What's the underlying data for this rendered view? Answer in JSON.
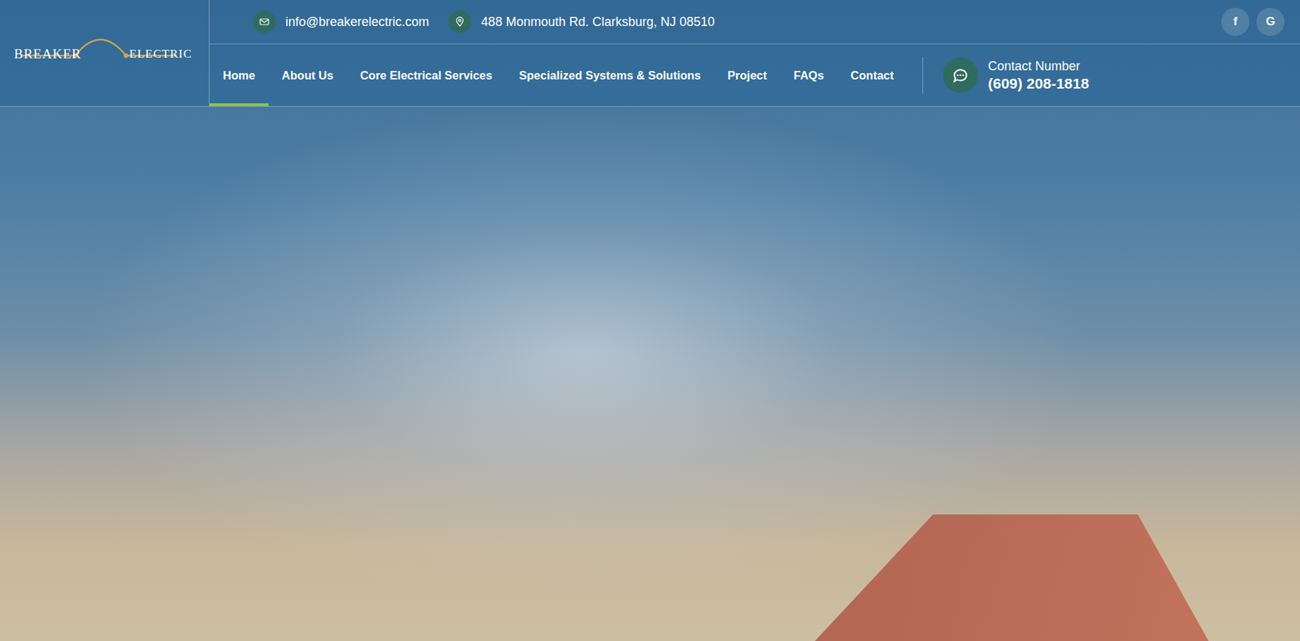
{
  "logo": {
    "left": "BREAKER",
    "right": "ELECTRIC"
  },
  "top_bar": {
    "email": "info@breakerelectric.com",
    "address": "488 Monmouth Rd. Clarksburg, NJ 08510"
  },
  "social": [
    "f",
    "G"
  ],
  "nav": [
    {
      "label": "Home",
      "selected": true
    },
    {
      "label": "About Us",
      "selected": false
    },
    {
      "label": "Core Electrical Services",
      "selected": false
    },
    {
      "label": "Specialized Systems & Solutions",
      "selected": false
    },
    {
      "label": "Project",
      "selected": false
    },
    {
      "label": "FAQs",
      "selected": false
    },
    {
      "label": "Contact",
      "selected": false
    }
  ],
  "contact": {
    "label": "Contact Number",
    "number": "(609) 208-1818"
  }
}
